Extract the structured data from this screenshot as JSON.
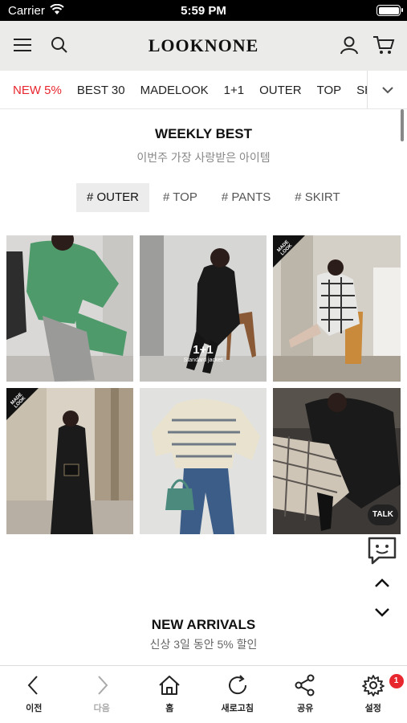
{
  "status_bar": {
    "carrier": "Carrier",
    "time": "5:59 PM"
  },
  "header": {
    "logo": "LOOKNONE"
  },
  "categories": [
    {
      "label": "NEW 5%",
      "active": true
    },
    {
      "label": "BEST 30"
    },
    {
      "label": "MADELOOK"
    },
    {
      "label": "1+1"
    },
    {
      "label": "OUTER"
    },
    {
      "label": "TOP"
    },
    {
      "label": "SHIRT"
    }
  ],
  "weekly": {
    "title": "WEEKLY BEST",
    "subtitle": "이번주 가장 사랑받은 아이템",
    "tags": [
      "# OUTER",
      "# TOP",
      "# PANTS",
      "# SKIRT"
    ]
  },
  "products": [
    {
      "badge": ""
    },
    {
      "badge": "",
      "overlay": "1+1",
      "overlay_sub": "Standard jacket"
    },
    {
      "badge": "MADE LOOK"
    },
    {
      "badge": "MADE LOOK"
    },
    {
      "badge": ""
    },
    {
      "badge": ""
    }
  ],
  "floating": {
    "talk": "TALK"
  },
  "new_arrivals": {
    "title": "NEW ARRIVALS",
    "subtitle": "신상 3일 동안 5% 할인"
  },
  "bottom_bar": {
    "back": "이전",
    "forward": "다음",
    "home": "홈",
    "refresh": "새로고침",
    "share": "공유",
    "settings": "설정",
    "notification_count": "1"
  },
  "colors": {
    "accent": "#e8262e",
    "header_bg": "#ebebe9"
  }
}
